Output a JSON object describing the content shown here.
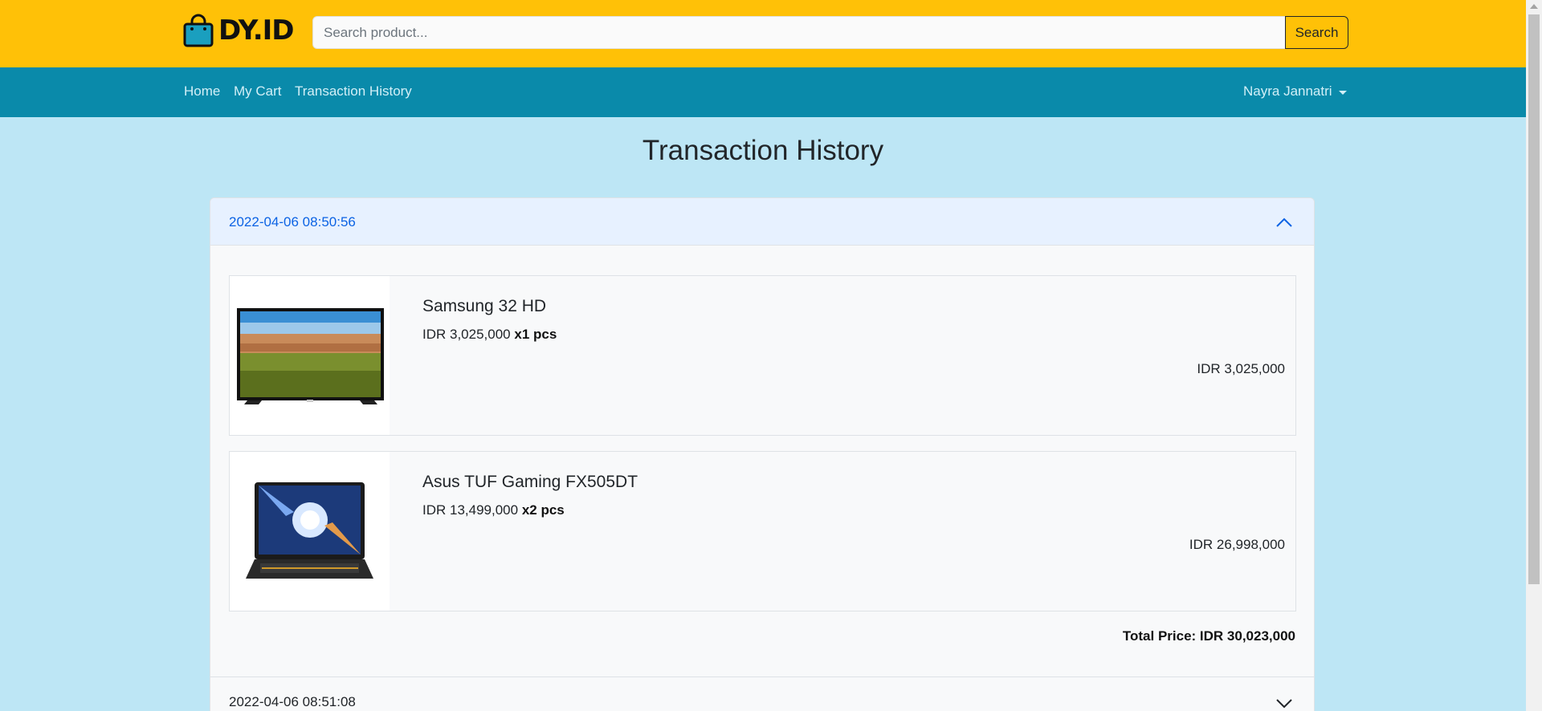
{
  "brand": {
    "logo_text": "DY.ID",
    "logo_icon": "shopping-bag-icon",
    "bar_color": "#ffc107"
  },
  "search": {
    "placeholder": "Search product...",
    "button_label": "Search"
  },
  "nav": {
    "items": [
      {
        "label": "Home"
      },
      {
        "label": "My Cart"
      },
      {
        "label": "Transaction History"
      }
    ],
    "user_name": "Nayra Jannatri",
    "bar_color": "#0a8aaa"
  },
  "page": {
    "title": "Transaction History"
  },
  "transactions": [
    {
      "timestamp": "2022-04-06 08:50:56",
      "expanded": true,
      "items": [
        {
          "name": "Samsung 32 HD",
          "unit_price": "IDR 3,025,000",
          "qty": "x1 pcs",
          "subtotal": "IDR 3,025,000",
          "image": "tv-image"
        },
        {
          "name": "Asus TUF Gaming FX505DT",
          "unit_price": "IDR 13,499,000",
          "qty": "x2 pcs",
          "subtotal": "IDR 26,998,000",
          "image": "laptop-image"
        }
      ],
      "total": "Total Price: IDR 30,023,000"
    },
    {
      "timestamp": "2022-04-06 08:51:08",
      "expanded": false
    }
  ]
}
